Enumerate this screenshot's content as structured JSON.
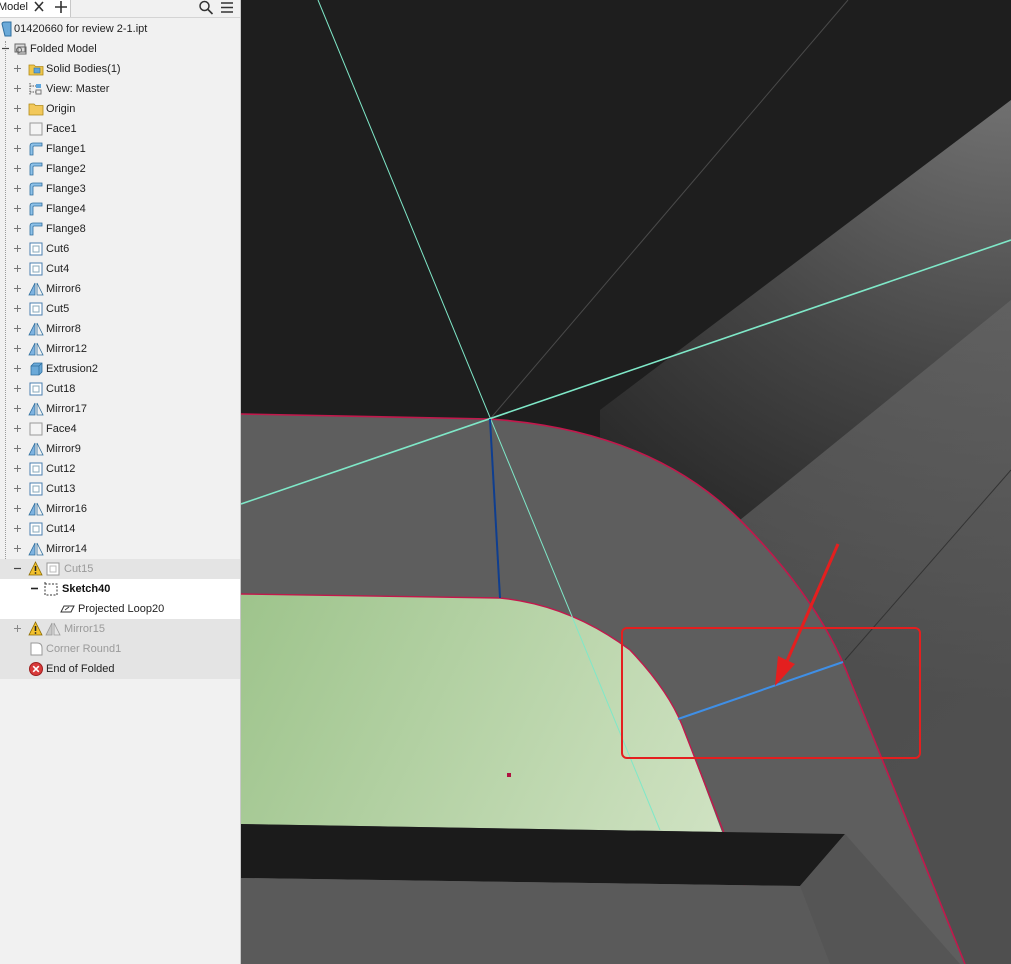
{
  "tabs": {
    "model_label": "Model"
  },
  "icons": {
    "close": "close-icon",
    "add": "plus-icon",
    "search": "search-icon",
    "menu": "hamburger-menu-icon"
  },
  "tree": {
    "document": "01420660 for review 2-1.ipt",
    "folded_model": "Folded Model",
    "items": [
      {
        "label": "Solid Bodies(1)",
        "icon": "solid-bodies-folder"
      },
      {
        "label": "View: Master",
        "icon": "view"
      },
      {
        "label": "Origin",
        "icon": "folder"
      },
      {
        "label": "Face1",
        "icon": "face"
      },
      {
        "label": "Flange1",
        "icon": "flange"
      },
      {
        "label": "Flange2",
        "icon": "flange"
      },
      {
        "label": "Flange3",
        "icon": "flange"
      },
      {
        "label": "Flange4",
        "icon": "flange"
      },
      {
        "label": "Flange8",
        "icon": "flange"
      },
      {
        "label": "Cut6",
        "icon": "cut"
      },
      {
        "label": "Cut4",
        "icon": "cut"
      },
      {
        "label": "Mirror6",
        "icon": "mirror"
      },
      {
        "label": "Cut5",
        "icon": "cut"
      },
      {
        "label": "Mirror8",
        "icon": "mirror"
      },
      {
        "label": "Mirror12",
        "icon": "mirror"
      },
      {
        "label": "Extrusion2",
        "icon": "extrusion"
      },
      {
        "label": "Cut18",
        "icon": "cut"
      },
      {
        "label": "Mirror17",
        "icon": "mirror"
      },
      {
        "label": "Face4",
        "icon": "face"
      },
      {
        "label": "Mirror9",
        "icon": "mirror"
      },
      {
        "label": "Cut12",
        "icon": "cut"
      },
      {
        "label": "Cut13",
        "icon": "cut"
      },
      {
        "label": "Mirror16",
        "icon": "mirror"
      },
      {
        "label": "Cut14",
        "icon": "cut"
      },
      {
        "label": "Mirror14",
        "icon": "mirror"
      }
    ],
    "cut15": {
      "label": "Cut15",
      "warning": true
    },
    "sketch40": {
      "label": "Sketch40"
    },
    "projected_loop": {
      "label": "Projected Loop20"
    },
    "mirror15": {
      "label": "Mirror15",
      "warning": true
    },
    "corner_round": {
      "label": "Corner Round1"
    },
    "end_of_folded": {
      "label": "End of Folded"
    }
  },
  "colors": {
    "viewport_bg": "#1e1e1e",
    "part_face": "#5f5f5f",
    "edge_highlight": "#c2184c",
    "sketch_face": "#a8c994",
    "axis_cyan": "#7fe8c8",
    "callout_red": "#e41f1f",
    "sketch_line": "#3f8fe6"
  }
}
